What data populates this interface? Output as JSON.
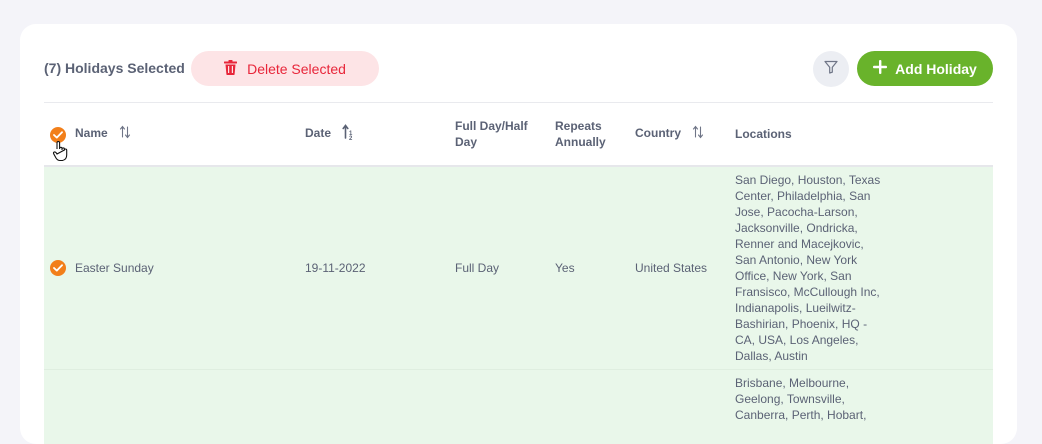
{
  "toolbar": {
    "selected_label": "(7) Holidays Selected",
    "delete_label": "Delete Selected",
    "add_label": "Add Holiday"
  },
  "table": {
    "headers": {
      "name": "Name",
      "date": "Date",
      "full_half": "Full Day/Half Day",
      "repeats": "Repeats Annually",
      "country": "Country",
      "locations": "Locations"
    },
    "rows": [
      {
        "name": "Easter Sunday",
        "date": "19-11-2022",
        "full_half": "Full Day",
        "repeats": "Yes",
        "country": "United States",
        "locations": "San Diego, Houston, Texas Center, Philadelphia, San Jose, Pacocha-Larson, Jacksonville, Ondricka, Renner and Macejkovic, San Antonio, New York Office, New York, San Fransisco, McCullough Inc, Indianapolis, Lueilwitz-Bashirian, Phoenix, HQ - CA, USA, Los Angeles, Dallas, Austin",
        "checked": true
      },
      {
        "name": "",
        "date": "",
        "full_half": "",
        "repeats": "",
        "country": "",
        "locations": "Brisbane, Melbourne, Geelong, Townsville, Canberra, Perth, Hobart,",
        "checked": true
      }
    ]
  },
  "icons": {
    "delete": "trash-icon",
    "filter": "filter-icon",
    "add": "plus-icon",
    "sort": "sort-icon",
    "check": "check-icon",
    "cursor": "hand-pointer-icon"
  },
  "colors": {
    "accent_green": "#69b32b",
    "danger_red": "#e8263a",
    "danger_bg": "#fde4e6",
    "checkbox_orange": "#f27f1a",
    "row_selected_bg": "#e9f7ea"
  }
}
